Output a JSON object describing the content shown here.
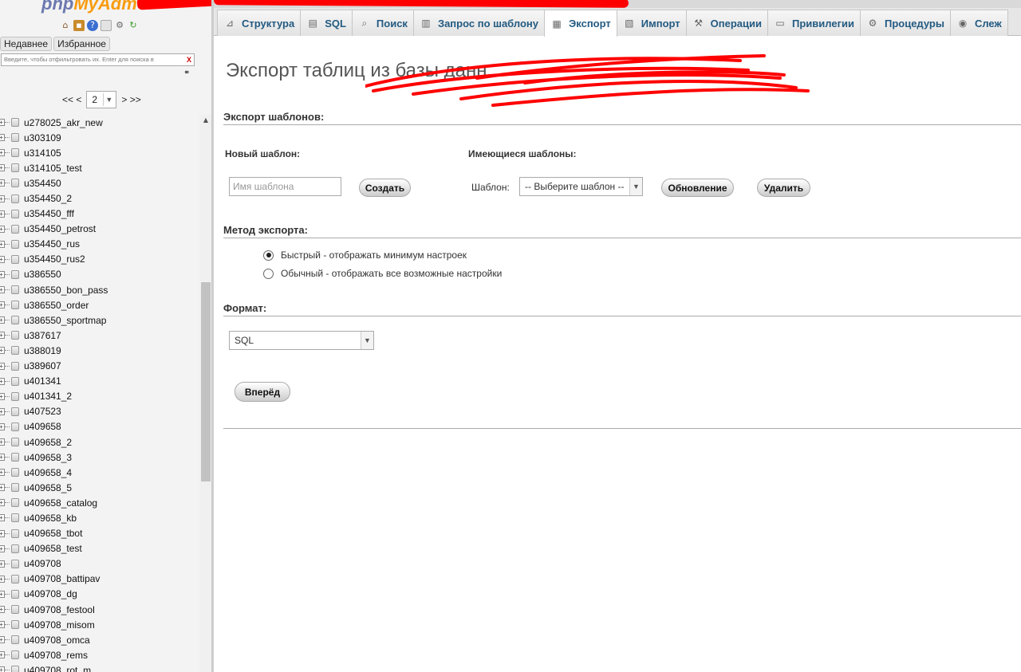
{
  "logo": {
    "part1": "php",
    "part2": "MyAdm"
  },
  "nav": {
    "icons": [
      "home-icon",
      "exit-icon",
      "help-icon",
      "docs-icon",
      "gear-icon",
      "reload-icon"
    ],
    "tabs": {
      "recent": "Недавнее",
      "favorites": "Избранное"
    },
    "filter_placeholder": "Введите, чтобы отфильтровать их. Enter для поиска в",
    "filter_clear": "X",
    "pager": {
      "prev": "<< <",
      "page": "2",
      "next": "> >>"
    },
    "databases": [
      "u278025_akr_new",
      "u303109",
      "u314105",
      "u314105_test",
      "u354450",
      "u354450_2",
      "u354450_fff",
      "u354450_petrost",
      "u354450_rus",
      "u354450_rus2",
      "u386550",
      "u386550_bon_pass",
      "u386550_order",
      "u386550_sportmap",
      "u387617",
      "u388019",
      "u389607",
      "u401341",
      "u401341_2",
      "u407523",
      "u409658",
      "u409658_2",
      "u409658_3",
      "u409658_4",
      "u409658_5",
      "u409658_catalog",
      "u409658_kb",
      "u409658_tbot",
      "u409658_test",
      "u409708",
      "u409708_battipav",
      "u409708_dg",
      "u409708_festool",
      "u409708_misom",
      "u409708_omca",
      "u409708_rems",
      "u409708_rot_m"
    ]
  },
  "tabs": [
    {
      "label": "Структура",
      "icon": "structure-icon",
      "glyph": "⊿"
    },
    {
      "label": "SQL",
      "icon": "sql-icon",
      "glyph": "▤"
    },
    {
      "label": "Поиск",
      "icon": "search-icon",
      "glyph": "⌕"
    },
    {
      "label": "Запрос по шаблону",
      "icon": "query-icon",
      "glyph": "▥"
    },
    {
      "label": "Экспорт",
      "icon": "export-icon",
      "glyph": "▦",
      "active": true
    },
    {
      "label": "Импорт",
      "icon": "import-icon",
      "glyph": "▧"
    },
    {
      "label": "Операции",
      "icon": "wrench-icon",
      "glyph": "⚒"
    },
    {
      "label": "Привилегии",
      "icon": "privileges-icon",
      "glyph": "▭"
    },
    {
      "label": "Процедуры",
      "icon": "routines-icon",
      "glyph": "⚙"
    },
    {
      "label": "Слеж",
      "icon": "tracking-icon",
      "glyph": "◉"
    }
  ],
  "main": {
    "title": "Экспорт таблиц из базы данн",
    "templates": {
      "heading": "Экспорт шаблонов:",
      "new_label": "Новый шаблон:",
      "existing_label": "Имеющиеся шаблоны:",
      "name_placeholder": "Имя шаблона",
      "create_button": "Создать",
      "template_label": "Шаблон:",
      "template_select": "-- Выберите шаблон --",
      "update_button": "Обновление",
      "delete_button": "Удалить"
    },
    "method": {
      "heading": "Метод экспорта:",
      "quick": "Быстрый - отображать минимум настроек",
      "custom": "Обычный - отображать все возможные настройки"
    },
    "format": {
      "heading": "Формат:",
      "value": "SQL"
    },
    "go_button": "Вперёд"
  }
}
